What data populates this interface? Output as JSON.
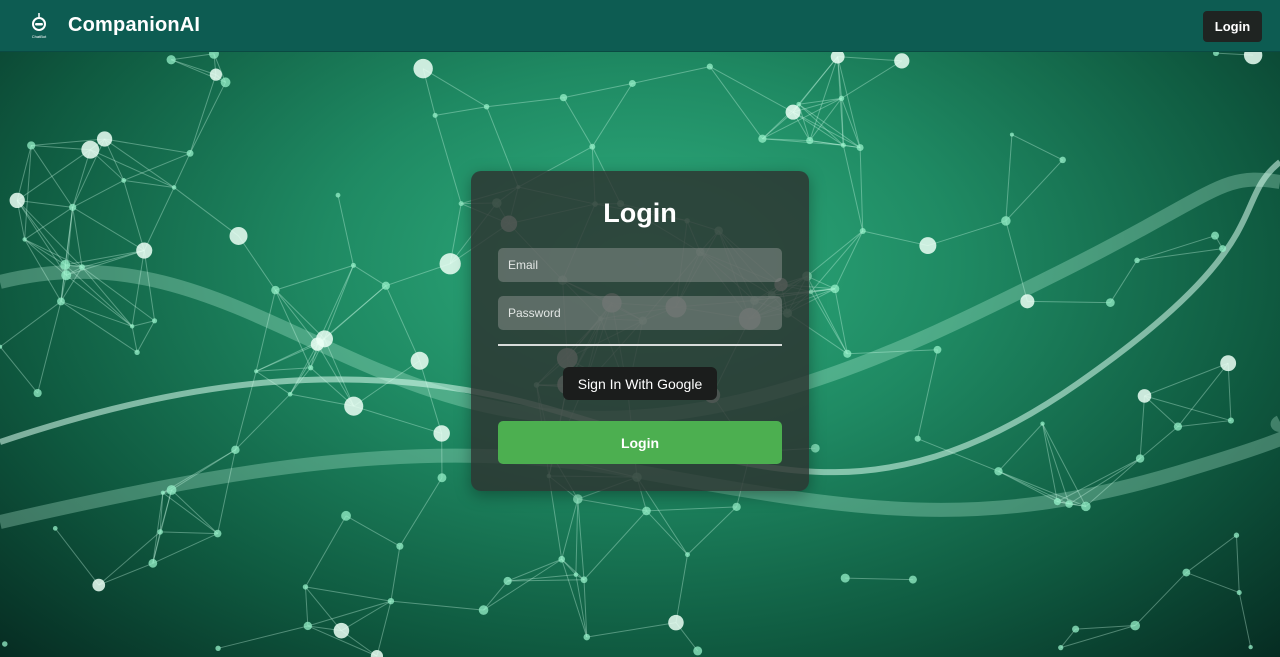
{
  "navbar": {
    "brand": "CompanionAI",
    "logo_icon": "robot-icon",
    "logo_caption": "ChatBot",
    "login_label": "Login",
    "background_color": "#0d5c52"
  },
  "login_card": {
    "title": "Login",
    "email": {
      "placeholder": "Email",
      "value": ""
    },
    "password": {
      "placeholder": "Password",
      "value": ""
    },
    "google_button_label": "Sign In With Google",
    "submit_label": "Login",
    "submit_color": "#4caf50"
  },
  "background": {
    "theme": "green-network-mesh",
    "accent": "#2fae7e"
  }
}
